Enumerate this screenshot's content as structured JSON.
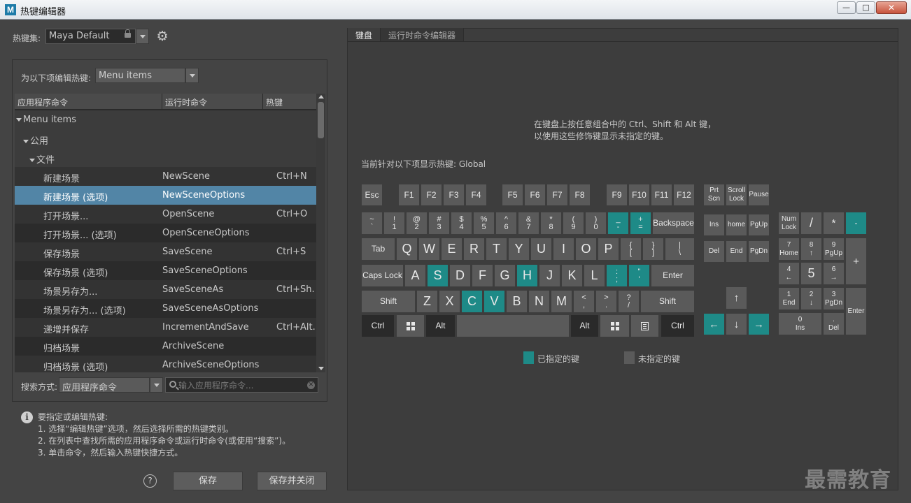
{
  "window": {
    "title": "热键编辑器",
    "app_icon": "M",
    "minimize": "—",
    "maximize": "□",
    "close": "✕"
  },
  "hotkey_set": {
    "label": "热键集:",
    "value": "Maya Default"
  },
  "edit_for": {
    "label": "为以下项编辑热键:",
    "value": "Menu items"
  },
  "table": {
    "columns": [
      "应用程序命令",
      "运行时命令",
      "热键"
    ],
    "tree": [
      "Menu items",
      "公用",
      "文件"
    ],
    "rows": [
      {
        "app": "新建场景",
        "runtime": "NewScene",
        "hotkey": "Ctrl+N"
      },
      {
        "app": "新建场景 (选项)",
        "runtime": "NewSceneOptions",
        "hotkey": ""
      },
      {
        "app": "打开场景...",
        "runtime": "OpenScene",
        "hotkey": "Ctrl+O"
      },
      {
        "app": "打开场景... (选项)",
        "runtime": "OpenSceneOptions",
        "hotkey": ""
      },
      {
        "app": "保存场景",
        "runtime": "SaveScene",
        "hotkey": "Ctrl+S"
      },
      {
        "app": "保存场景 (选项)",
        "runtime": "SaveSceneOptions",
        "hotkey": ""
      },
      {
        "app": "场景另存为...",
        "runtime": "SaveSceneAs",
        "hotkey": "Ctrl+Sh..."
      },
      {
        "app": "场景另存为... (选项)",
        "runtime": "SaveSceneAsOptions",
        "hotkey": ""
      },
      {
        "app": "递增并保存",
        "runtime": "IncrementAndSave",
        "hotkey": "Ctrl+Alt..."
      },
      {
        "app": "归档场景",
        "runtime": "ArchiveScene",
        "hotkey": ""
      },
      {
        "app": "归档场景 (选项)",
        "runtime": "ArchiveSceneOptions",
        "hotkey": ""
      }
    ]
  },
  "search": {
    "label": "搜索方式:",
    "mode": "应用程序命令",
    "placeholder": "输入应用程序命令..."
  },
  "help": {
    "title": "要指定或编辑热键:",
    "step1": "1. 选择“编辑热键”选项，然后选择所需的热键类别。",
    "step2": "2. 在列表中查找所需的应用程序命令或运行时命令(或使用“搜索”)。",
    "step3": "3. 单击命令，然后输入热键快捷方式。",
    "help_glyph": "?"
  },
  "buttons": {
    "save": "保存",
    "save_close": "保存并关闭"
  },
  "tabs": [
    "键盘",
    "运行时命令编辑器"
  ],
  "keyboard_message": {
    "line1": "在键盘上按任意组合中的 Ctrl、Shift 和 Alt 键，",
    "line2": "以使用这些修饰键显示未指定的键。"
  },
  "current_context": "当前针对以下项显示热键: Global",
  "colors": {
    "assigned": "#1e8a87",
    "unassigned": "#5a5a5a",
    "selected_row": "#5285a6"
  },
  "legend": {
    "assigned": "已指定的键",
    "unassigned": "未指定的键"
  },
  "keys": {
    "esc": "Esc",
    "f1": "F1",
    "f2": "F2",
    "f3": "F3",
    "f4": "F4",
    "f5": "F5",
    "f6": "F6",
    "f7": "F7",
    "f8": "F8",
    "f9": "F9",
    "f10": "F10",
    "f11": "F11",
    "f12": "F12",
    "prtscn": [
      "Prt",
      "Scn"
    ],
    "scroll": [
      "Scroll",
      "Lock"
    ],
    "pause": "Pause",
    "tilde": [
      "~",
      "`"
    ],
    "k1": [
      "!",
      "1"
    ],
    "k2": [
      "@",
      "2"
    ],
    "k3": [
      "#",
      "3"
    ],
    "k4": [
      "$",
      "4"
    ],
    "k5": [
      "%",
      "5"
    ],
    "k6": [
      "^",
      "6"
    ],
    "k7": [
      "&",
      "7"
    ],
    "k8": [
      "*",
      "8"
    ],
    "k9": [
      "(",
      "9"
    ],
    "k0": [
      ")",
      "0"
    ],
    "minus": [
      "_",
      "-"
    ],
    "equal": [
      "+",
      "="
    ],
    "backspace": "Backspace",
    "ins": "Ins",
    "home": "home",
    "pgup": "PgUp",
    "numlock": [
      "Num",
      "Lock"
    ],
    "numdiv": "/",
    "nummul": "*",
    "numsub": "-",
    "tab": "Tab",
    "q": "Q",
    "w": "W",
    "e": "E",
    "r": "R",
    "t": "T",
    "y": "Y",
    "u": "U",
    "i": "I",
    "o": "O",
    "p": "P",
    "lbracket": [
      "{",
      "["
    ],
    "rbracket": [
      "}",
      "]"
    ],
    "backslash": [
      "|",
      "\\"
    ],
    "del": "Del",
    "end": "End",
    "pgdn": "PgDn",
    "num7": [
      "7",
      "Home"
    ],
    "num8": [
      "8",
      "↑"
    ],
    "num9": [
      "9",
      "PgUp"
    ],
    "numadd": "+",
    "caps": "Caps Lock",
    "a": "A",
    "s": "S",
    "d": "D",
    "f": "F",
    "g": "G",
    "h": "H",
    "j": "J",
    "k": "K",
    "l": "L",
    "semicolon": [
      ":",
      ";"
    ],
    "quote": [
      "\"",
      "'"
    ],
    "enter": "Enter",
    "num4": [
      "4",
      "←"
    ],
    "num5": "5",
    "num6": [
      "6",
      "→"
    ],
    "lshift": "Shift",
    "z": "Z",
    "x": "X",
    "c": "C",
    "v": "V",
    "b": "B",
    "n": "N",
    "m": "M",
    "comma": [
      "<",
      ","
    ],
    "period": [
      ">",
      "."
    ],
    "slash": [
      "?",
      "/"
    ],
    "rshift": "Shift",
    "up": "↑",
    "num1": [
      "1",
      "End"
    ],
    "num2": [
      "2",
      "↓"
    ],
    "num3": [
      "3",
      "PgDn"
    ],
    "numenter": "Enter",
    "lctrl": "Ctrl",
    "lalt": "Alt",
    "ralt": "Alt",
    "rctrl": "Ctrl",
    "left": "←",
    "down": "↓",
    "right": "→",
    "num0": [
      "0",
      "Ins"
    ],
    "numdot": [
      ".",
      "Del"
    ]
  },
  "watermark": "最需教育"
}
